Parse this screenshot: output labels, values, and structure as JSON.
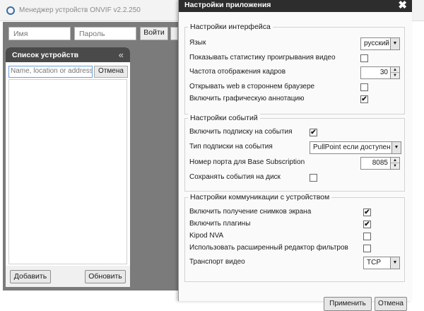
{
  "app": {
    "title": "Менеджер устройств ONVIF v2.2.250",
    "login": {
      "name_placeholder": "Имя",
      "password_placeholder": "Пароль",
      "login_button": "Войти"
    },
    "device_list": {
      "title": "Список устройств",
      "collapse_icon": "«",
      "search_placeholder": "Name, location or address",
      "cancel_button": "Отмена",
      "add_button": "Добавить",
      "refresh_button": "Обновить"
    }
  },
  "dialog": {
    "title": "Настройки приложения",
    "close_icon": "✖",
    "interface": {
      "title": "Настройки интерфейса",
      "language_label": "Язык",
      "language_value": "русский",
      "show_stats_label": "Показывать статистику проигрывания видео",
      "show_stats_checked": false,
      "frame_rate_label": "Частота отображения кадров",
      "frame_rate_value": "30",
      "open_web_label": "Открывать web в стороннем браузере",
      "open_web_checked": false,
      "graphic_annotation_label": "Включить графическую аннотацию",
      "graphic_annotation_checked": true
    },
    "events": {
      "title": "Настройки событий",
      "subscribe_label": "Включить подписку на события",
      "subscribe_checked": true,
      "subscription_type_label": "Тип подписки на события",
      "subscription_type_value": "PullPoint если доступен",
      "port_label": "Номер порта для Base Subscription",
      "port_value": "8085",
      "save_events_label": "Сохранять события на диск",
      "save_events_checked": false
    },
    "communication": {
      "title": "Настройки коммуникации с устройством",
      "snapshots_label": "Включить получение снимков экрана",
      "snapshots_checked": true,
      "plugins_label": "Включить плагины",
      "plugins_checked": true,
      "kipod_label": "Kipod NVA",
      "kipod_checked": false,
      "advanced_filter_label": "Использовать расширенный редактор фильтров",
      "advanced_filter_checked": false,
      "transport_label": "Транспорт видео",
      "transport_value": "TCP"
    },
    "apply_button": "Применить",
    "cancel_button": "Отмена"
  },
  "check_glyph": "✔"
}
